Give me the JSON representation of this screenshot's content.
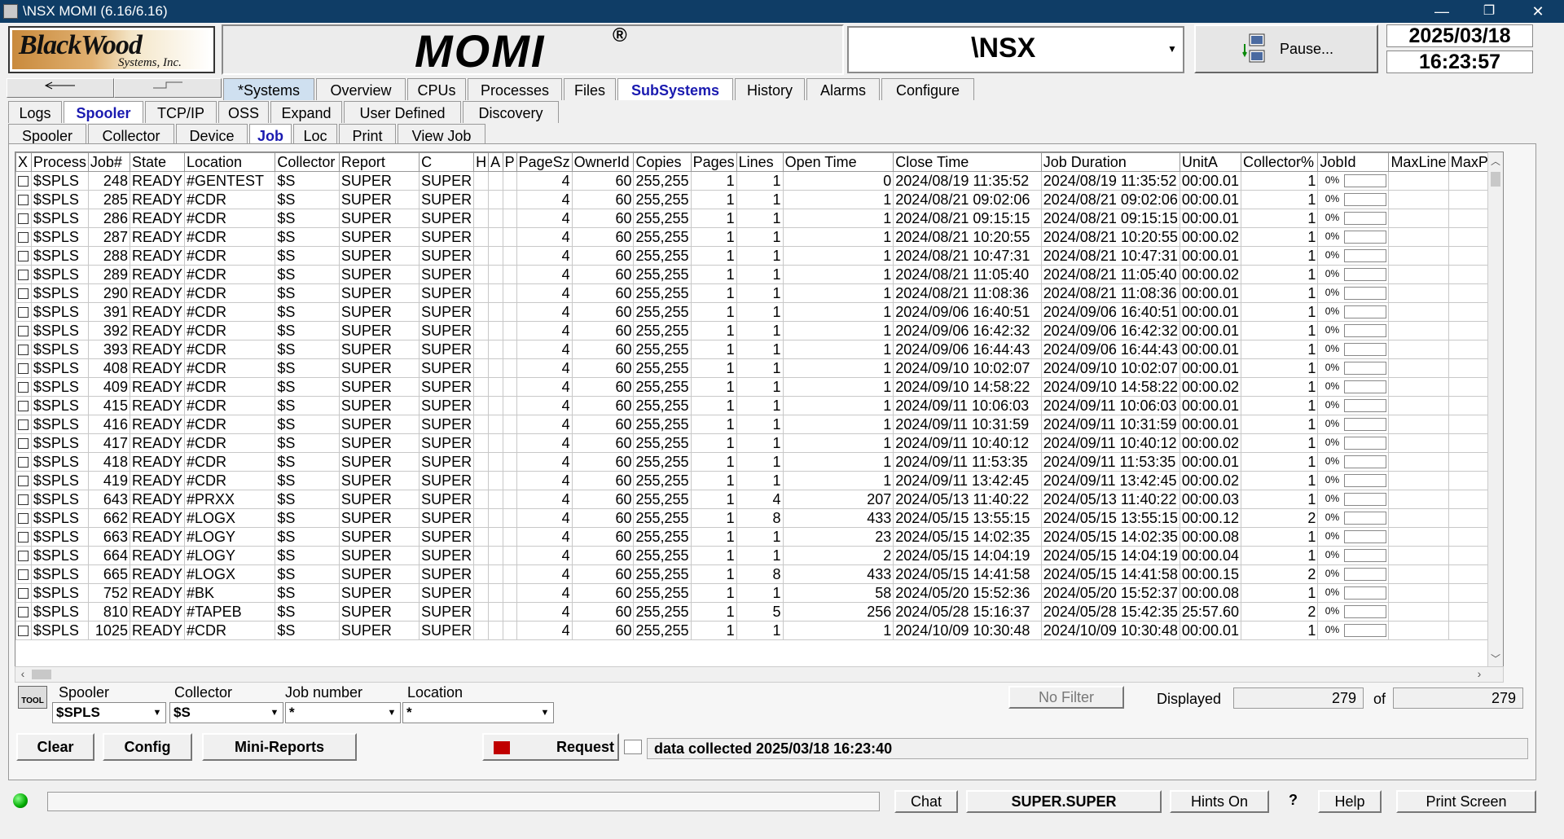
{
  "window": {
    "title": "\\NSX MOMI (6.16/6.16)",
    "minimize": "—",
    "restore": "❐",
    "close": "✕"
  },
  "header": {
    "logo_text": "BlackWood",
    "logo_sub": "Systems, Inc.",
    "momi": "MOMI",
    "momi_mark": "®",
    "system": "\\NSX",
    "pause_label": "Pause...",
    "date": "2025/03/18",
    "time": "16:23:57"
  },
  "main_tabs": [
    "*Systems",
    "Overview",
    "CPUs",
    "Processes",
    "Files",
    "SubSystems",
    "History",
    "Alarms",
    "Configure"
  ],
  "sub_tabs": [
    "Logs",
    "Spooler",
    "TCP/IP",
    "OSS",
    "Expand",
    "User Defined",
    "Discovery"
  ],
  "spooler_tabs": [
    "Spooler",
    "Collector",
    "Device",
    "Job",
    "Loc",
    "Print",
    "View Job"
  ],
  "columns": [
    "X",
    "Process",
    "Job#",
    "State",
    "Location",
    "Collector",
    "Report",
    "C",
    "H",
    "A",
    "P",
    "PageSz",
    "OwnerId",
    "Copies",
    "Pages",
    "Lines",
    "Open Time",
    "Close Time",
    "Job Duration",
    "UnitA",
    "Collector%",
    "JobId",
    "MaxLine",
    "MaxPa"
  ],
  "rows": [
    [
      "$SPLS",
      "248",
      "READY",
      "#GENTEST",
      "$S",
      "SUPER",
      "SUPER",
      "",
      "",
      "",
      "4",
      "60",
      "255,255",
      "1",
      "1",
      "0",
      "2024/08/19 11:35:52",
      "2024/08/19 11:35:52",
      "00:00.01",
      "1",
      "0%"
    ],
    [
      "$SPLS",
      "285",
      "READY",
      "#CDR",
      "$S",
      "SUPER",
      "SUPER",
      "",
      "",
      "",
      "4",
      "60",
      "255,255",
      "1",
      "1",
      "1",
      "2024/08/21 09:02:06",
      "2024/08/21 09:02:06",
      "00:00.01",
      "1",
      "0%"
    ],
    [
      "$SPLS",
      "286",
      "READY",
      "#CDR",
      "$S",
      "SUPER",
      "SUPER",
      "",
      "",
      "",
      "4",
      "60",
      "255,255",
      "1",
      "1",
      "1",
      "2024/08/21 09:15:15",
      "2024/08/21 09:15:15",
      "00:00.01",
      "1",
      "0%"
    ],
    [
      "$SPLS",
      "287",
      "READY",
      "#CDR",
      "$S",
      "SUPER",
      "SUPER",
      "",
      "",
      "",
      "4",
      "60",
      "255,255",
      "1",
      "1",
      "1",
      "2024/08/21 10:20:55",
      "2024/08/21 10:20:55",
      "00:00.02",
      "1",
      "0%"
    ],
    [
      "$SPLS",
      "288",
      "READY",
      "#CDR",
      "$S",
      "SUPER",
      "SUPER",
      "",
      "",
      "",
      "4",
      "60",
      "255,255",
      "1",
      "1",
      "1",
      "2024/08/21 10:47:31",
      "2024/08/21 10:47:31",
      "00:00.01",
      "1",
      "0%"
    ],
    [
      "$SPLS",
      "289",
      "READY",
      "#CDR",
      "$S",
      "SUPER",
      "SUPER",
      "",
      "",
      "",
      "4",
      "60",
      "255,255",
      "1",
      "1",
      "1",
      "2024/08/21 11:05:40",
      "2024/08/21 11:05:40",
      "00:00.02",
      "1",
      "0%"
    ],
    [
      "$SPLS",
      "290",
      "READY",
      "#CDR",
      "$S",
      "SUPER",
      "SUPER",
      "",
      "",
      "",
      "4",
      "60",
      "255,255",
      "1",
      "1",
      "1",
      "2024/08/21 11:08:36",
      "2024/08/21 11:08:36",
      "00:00.01",
      "1",
      "0%"
    ],
    [
      "$SPLS",
      "391",
      "READY",
      "#CDR",
      "$S",
      "SUPER",
      "SUPER",
      "",
      "",
      "",
      "4",
      "60",
      "255,255",
      "1",
      "1",
      "1",
      "2024/09/06 16:40:51",
      "2024/09/06 16:40:51",
      "00:00.01",
      "1",
      "0%"
    ],
    [
      "$SPLS",
      "392",
      "READY",
      "#CDR",
      "$S",
      "SUPER",
      "SUPER",
      "",
      "",
      "",
      "4",
      "60",
      "255,255",
      "1",
      "1",
      "1",
      "2024/09/06 16:42:32",
      "2024/09/06 16:42:32",
      "00:00.01",
      "1",
      "0%"
    ],
    [
      "$SPLS",
      "393",
      "READY",
      "#CDR",
      "$S",
      "SUPER",
      "SUPER",
      "",
      "",
      "",
      "4",
      "60",
      "255,255",
      "1",
      "1",
      "1",
      "2024/09/06 16:44:43",
      "2024/09/06 16:44:43",
      "00:00.01",
      "1",
      "0%"
    ],
    [
      "$SPLS",
      "408",
      "READY",
      "#CDR",
      "$S",
      "SUPER",
      "SUPER",
      "",
      "",
      "",
      "4",
      "60",
      "255,255",
      "1",
      "1",
      "1",
      "2024/09/10 10:02:07",
      "2024/09/10 10:02:07",
      "00:00.01",
      "1",
      "0%"
    ],
    [
      "$SPLS",
      "409",
      "READY",
      "#CDR",
      "$S",
      "SUPER",
      "SUPER",
      "",
      "",
      "",
      "4",
      "60",
      "255,255",
      "1",
      "1",
      "1",
      "2024/09/10 14:58:22",
      "2024/09/10 14:58:22",
      "00:00.02",
      "1",
      "0%"
    ],
    [
      "$SPLS",
      "415",
      "READY",
      "#CDR",
      "$S",
      "SUPER",
      "SUPER",
      "",
      "",
      "",
      "4",
      "60",
      "255,255",
      "1",
      "1",
      "1",
      "2024/09/11 10:06:03",
      "2024/09/11 10:06:03",
      "00:00.01",
      "1",
      "0%"
    ],
    [
      "$SPLS",
      "416",
      "READY",
      "#CDR",
      "$S",
      "SUPER",
      "SUPER",
      "",
      "",
      "",
      "4",
      "60",
      "255,255",
      "1",
      "1",
      "1",
      "2024/09/11 10:31:59",
      "2024/09/11 10:31:59",
      "00:00.01",
      "1",
      "0%"
    ],
    [
      "$SPLS",
      "417",
      "READY",
      "#CDR",
      "$S",
      "SUPER",
      "SUPER",
      "",
      "",
      "",
      "4",
      "60",
      "255,255",
      "1",
      "1",
      "1",
      "2024/09/11 10:40:12",
      "2024/09/11 10:40:12",
      "00:00.02",
      "1",
      "0%"
    ],
    [
      "$SPLS",
      "418",
      "READY",
      "#CDR",
      "$S",
      "SUPER",
      "SUPER",
      "",
      "",
      "",
      "4",
      "60",
      "255,255",
      "1",
      "1",
      "1",
      "2024/09/11 11:53:35",
      "2024/09/11 11:53:35",
      "00:00.01",
      "1",
      "0%"
    ],
    [
      "$SPLS",
      "419",
      "READY",
      "#CDR",
      "$S",
      "SUPER",
      "SUPER",
      "",
      "",
      "",
      "4",
      "60",
      "255,255",
      "1",
      "1",
      "1",
      "2024/09/11 13:42:45",
      "2024/09/11 13:42:45",
      "00:00.02",
      "1",
      "0%"
    ],
    [
      "$SPLS",
      "643",
      "READY",
      "#PRXX",
      "$S",
      "SUPER",
      "SUPER",
      "",
      "",
      "",
      "4",
      "60",
      "255,255",
      "1",
      "4",
      "207",
      "2024/05/13 11:40:22",
      "2024/05/13 11:40:22",
      "00:00.03",
      "1",
      "0%"
    ],
    [
      "$SPLS",
      "662",
      "READY",
      "#LOGX",
      "$S",
      "SUPER",
      "SUPER",
      "",
      "",
      "",
      "4",
      "60",
      "255,255",
      "1",
      "8",
      "433",
      "2024/05/15 13:55:15",
      "2024/05/15 13:55:15",
      "00:00.12",
      "2",
      "0%"
    ],
    [
      "$SPLS",
      "663",
      "READY",
      "#LOGY",
      "$S",
      "SUPER",
      "SUPER",
      "",
      "",
      "",
      "4",
      "60",
      "255,255",
      "1",
      "1",
      "23",
      "2024/05/15 14:02:35",
      "2024/05/15 14:02:35",
      "00:00.08",
      "1",
      "0%"
    ],
    [
      "$SPLS",
      "664",
      "READY",
      "#LOGY",
      "$S",
      "SUPER",
      "SUPER",
      "",
      "",
      "",
      "4",
      "60",
      "255,255",
      "1",
      "1",
      "2",
      "2024/05/15 14:04:19",
      "2024/05/15 14:04:19",
      "00:00.04",
      "1",
      "0%"
    ],
    [
      "$SPLS",
      "665",
      "READY",
      "#LOGX",
      "$S",
      "SUPER",
      "SUPER",
      "",
      "",
      "",
      "4",
      "60",
      "255,255",
      "1",
      "8",
      "433",
      "2024/05/15 14:41:58",
      "2024/05/15 14:41:58",
      "00:00.15",
      "2",
      "0%"
    ],
    [
      "$SPLS",
      "752",
      "READY",
      "#BK",
      "$S",
      "SUPER",
      "SUPER",
      "",
      "",
      "",
      "4",
      "60",
      "255,255",
      "1",
      "1",
      "58",
      "2024/05/20 15:52:36",
      "2024/05/20 15:52:37",
      "00:00.08",
      "1",
      "0%"
    ],
    [
      "$SPLS",
      "810",
      "READY",
      "#TAPEB",
      "$S",
      "SUPER",
      "SUPER",
      "",
      "",
      "",
      "4",
      "60",
      "255,255",
      "1",
      "5",
      "256",
      "2024/05/28 15:16:37",
      "2024/05/28 15:42:35",
      "25:57.60",
      "2",
      "0%"
    ],
    [
      "$SPLS",
      "1025",
      "READY",
      "#CDR",
      "$S",
      "SUPER",
      "SUPER",
      "",
      "",
      "",
      "4",
      "60",
      "255,255",
      "1",
      "1",
      "1",
      "2024/10/09 10:30:48",
      "2024/10/09 10:30:48",
      "00:00.01",
      "1",
      "0%"
    ]
  ],
  "filters": {
    "spooler_label": "Spooler",
    "spooler_value": "$SPLS",
    "collector_label": "Collector",
    "collector_value": "$S",
    "job_label": "Job number",
    "job_value": "*",
    "location_label": "Location",
    "location_value": "*",
    "no_filter": "No Filter",
    "displayed_label": "Displayed",
    "displayed_value": "279",
    "of_label": "of",
    "total_value": "279"
  },
  "buttons": {
    "clear": "Clear",
    "config": "Config",
    "mini_reports": "Mini-Reports",
    "request": "Request"
  },
  "status": "data collected 2025/03/18 16:23:40",
  "footer": {
    "chat": "Chat",
    "user": "SUPER.SUPER",
    "hints": "Hints On",
    "question": "?",
    "help": "Help",
    "print_screen": "Print Screen"
  },
  "tool_icon_label": "TOOL"
}
